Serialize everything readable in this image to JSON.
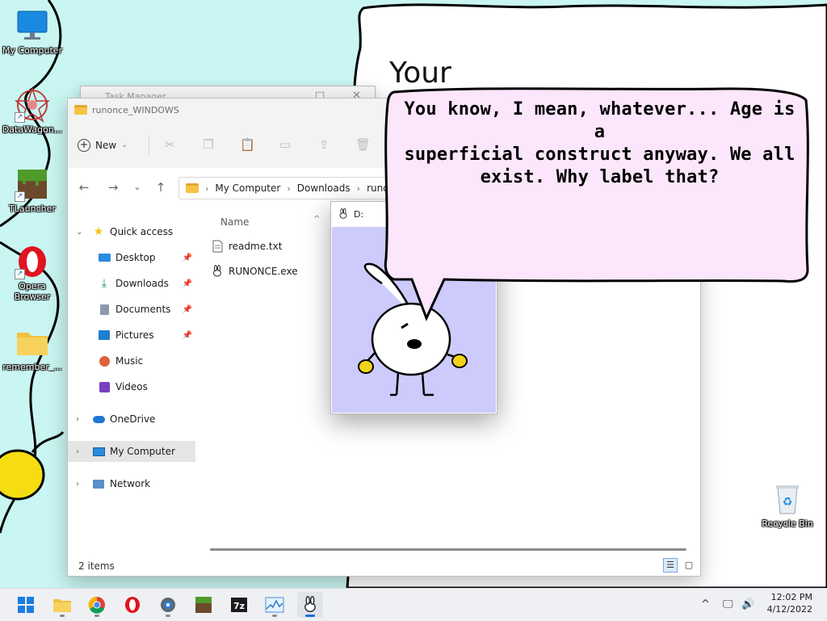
{
  "desktop": {
    "icons": [
      {
        "label": "My Computer"
      },
      {
        "label": "DataWagon..."
      },
      {
        "label": "TLauncher"
      },
      {
        "label": "Opera Browser"
      },
      {
        "label": "remember_..."
      },
      {
        "label": "Recycle Bin"
      }
    ],
    "wallpaper_text": "Your"
  },
  "task_manager": {
    "title": "Task Manager"
  },
  "explorer": {
    "title": "runonce_WINDOWS",
    "toolbar": {
      "new_label": "New"
    },
    "breadcrumb": [
      "My Computer",
      "Downloads",
      "runonce_WINDOWS"
    ],
    "nav": {
      "quick_access": "Quick access",
      "items": [
        "Desktop",
        "Downloads",
        "Documents",
        "Pictures",
        "Music",
        "Videos"
      ],
      "onedrive": "OneDrive",
      "my_computer": "My Computer",
      "network": "Network"
    },
    "column_name": "Name",
    "files": [
      {
        "name": "readme.txt"
      },
      {
        "name": "RUNONCE.exe"
      }
    ],
    "status": "2 items"
  },
  "image_window": {
    "title": "D:"
  },
  "speech_bubble": {
    "line1": "You know, I mean, whatever... Age is a",
    "line2": "superficial construct anyway. We all",
    "line3": "exist. Why label that?"
  },
  "taskbar": {
    "apps": [
      "start",
      "file-explorer",
      "chrome",
      "opera",
      "settings",
      "minecraft",
      "7zip",
      "task-manager",
      "runonce"
    ],
    "time": "12:02 PM",
    "date": "4/12/2022"
  },
  "colors": {
    "desktop_bg": "#c9f6f2",
    "bubble_fill": "#fbe6fb",
    "image_bg": "#cccbfb",
    "accent": "#1a6fd6"
  }
}
